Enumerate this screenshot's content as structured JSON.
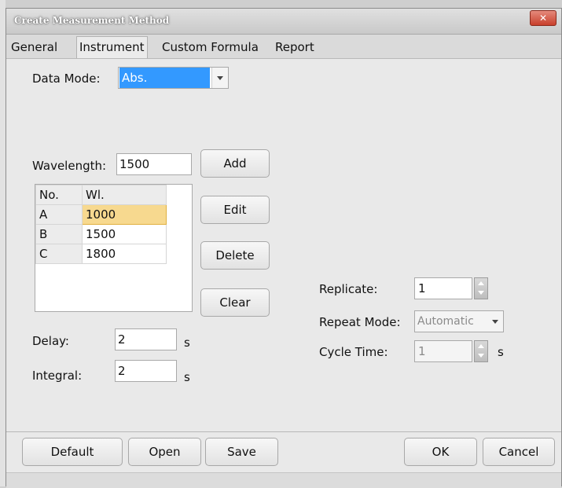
{
  "window": {
    "title": "Create Measurement Method",
    "close": "✕"
  },
  "tabs": [
    "General",
    "Instrument",
    "Custom Formula",
    "Report"
  ],
  "data_mode": {
    "label": "Data Mode:",
    "value": "Abs."
  },
  "wavelength": {
    "label": "Wavelength:",
    "value": "1500"
  },
  "buttons": {
    "add": "Add",
    "edit": "Edit",
    "delete": "Delete",
    "clear": "Clear"
  },
  "table": {
    "headers": [
      "No.",
      "Wl."
    ],
    "rows": [
      {
        "no": "A",
        "wl": "1000",
        "selected": true
      },
      {
        "no": "B",
        "wl": "1500",
        "selected": false
      },
      {
        "no": "C",
        "wl": "1800",
        "selected": false
      }
    ]
  },
  "delay": {
    "label": "Delay:",
    "value": "2",
    "unit": "s"
  },
  "integral": {
    "label": "Integral:",
    "value": "2",
    "unit": "s"
  },
  "replicate": {
    "label": "Replicate:",
    "value": "1"
  },
  "repeat_mode": {
    "label": "Repeat Mode:",
    "value": "Automatic"
  },
  "cycle_time": {
    "label": "Cycle Time:",
    "value": "1",
    "unit": "s"
  },
  "footer": {
    "default": "Default",
    "open": "Open",
    "save": "Save",
    "ok": "OK",
    "cancel": "Cancel"
  },
  "colors": {
    "selection": "#3399ff",
    "selected_cell": "#f7d98f"
  }
}
